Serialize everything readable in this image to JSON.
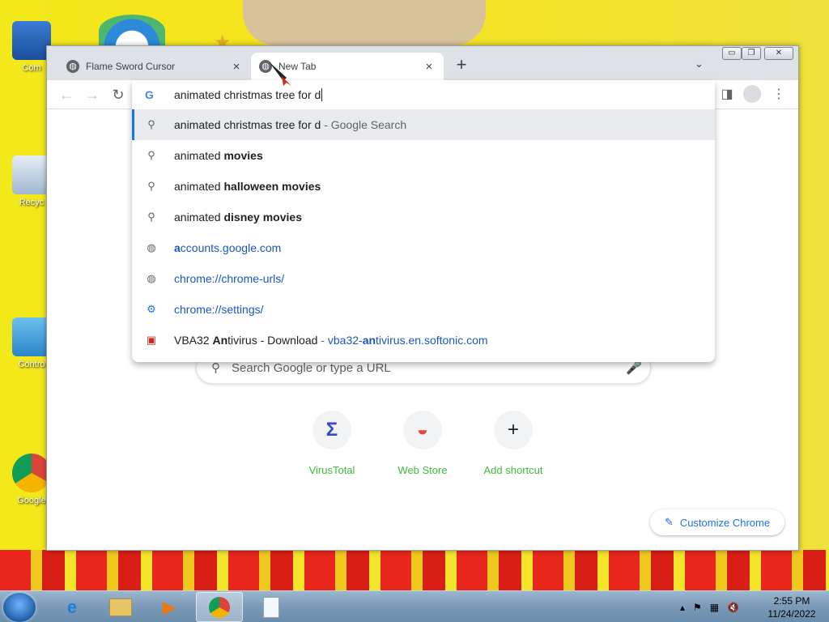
{
  "desktop": {
    "icons": [
      {
        "label": "Com"
      },
      {
        "label": "Recyc"
      },
      {
        "label": "Contro"
      },
      {
        "label": "Google"
      }
    ]
  },
  "browser": {
    "tabs": [
      {
        "title": "Flame Sword Cursor",
        "active": false
      },
      {
        "title": "New Tab",
        "active": true
      }
    ],
    "new_tab_symbol": "+",
    "tab_search_symbol": "⌄",
    "window_controls": [
      "▭",
      "❐",
      "✕"
    ]
  },
  "omnibox": {
    "typed": "animated christmas tree for d",
    "suggestions": [
      {
        "icon": "search-icon",
        "parts": [
          {
            "t": "animated christmas tree for d",
            "s": "n"
          },
          {
            "t": " - Google Search",
            "s": "dim"
          }
        ],
        "selected": true
      },
      {
        "icon": "search-icon",
        "parts": [
          {
            "t": "animated ",
            "s": "n"
          },
          {
            "t": "movies",
            "s": "b"
          }
        ]
      },
      {
        "icon": "search-icon",
        "parts": [
          {
            "t": "animated ",
            "s": "n"
          },
          {
            "t": "halloween movies",
            "s": "b"
          }
        ]
      },
      {
        "icon": "search-icon",
        "parts": [
          {
            "t": "animated ",
            "s": "n"
          },
          {
            "t": "disney movies",
            "s": "b"
          }
        ]
      },
      {
        "icon": "globe-icon",
        "parts": [
          {
            "t": "a",
            "s": "ub"
          },
          {
            "t": "ccounts.google.com",
            "s": "u"
          }
        ]
      },
      {
        "icon": "globe-icon",
        "parts": [
          {
            "t": "chrome://chrome-urls/",
            "s": "u"
          }
        ]
      },
      {
        "icon": "settings-icon",
        "parts": [
          {
            "t": "chrome://settings/",
            "s": "u"
          }
        ]
      },
      {
        "icon": "site-favicon-icon",
        "parts": [
          {
            "t": "VBA32 ",
            "s": "n"
          },
          {
            "t": "An",
            "s": "b"
          },
          {
            "t": "tivirus - Download",
            "s": "n"
          },
          {
            "t": " - ",
            "s": "dim"
          },
          {
            "t": "vba32-",
            "s": "u"
          },
          {
            "t": "an",
            "s": "ub"
          },
          {
            "t": "tivirus.en.softonic.com",
            "s": "u"
          }
        ]
      }
    ]
  },
  "newtab": {
    "search_placeholder": "Search Google or type a URL",
    "shortcuts": [
      {
        "label": "VirusTotal",
        "symbol": "Σ"
      },
      {
        "label": "Web Store",
        "symbol": "◒"
      },
      {
        "label": "Add shortcut",
        "symbol": "+"
      }
    ],
    "customize_label": "Customize Chrome"
  },
  "taskbar": {
    "clock_time": "2:55 PM",
    "clock_date": "11/24/2022"
  }
}
